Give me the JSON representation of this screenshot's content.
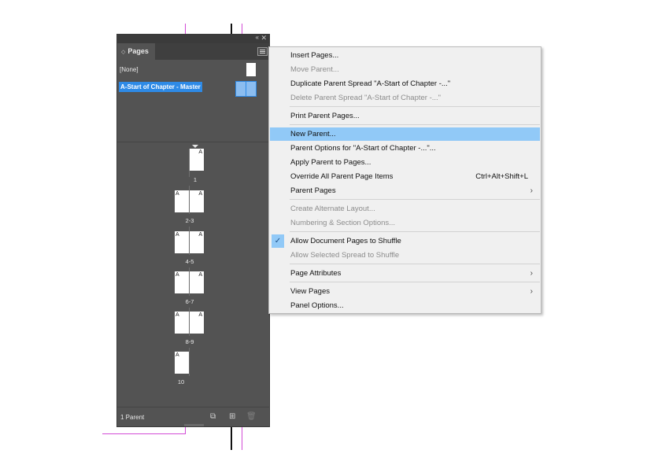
{
  "panel": {
    "tab_label": "Pages",
    "collapse_glyph": "«",
    "close_glyph": "✕",
    "parents": [
      {
        "label": "[None]"
      },
      {
        "label": "A-Start of Chapter - Master",
        "selected": true
      }
    ],
    "spreads": [
      {
        "label": "1",
        "pages": [
          "A"
        ]
      },
      {
        "label": "2-3",
        "pages": [
          "A",
          "A"
        ]
      },
      {
        "label": "4-5",
        "pages": [
          "A",
          "A"
        ]
      },
      {
        "label": "6-7",
        "pages": [
          "A",
          "A"
        ]
      },
      {
        "label": "8-9",
        "pages": [
          "A",
          "A"
        ]
      },
      {
        "label": "10",
        "pages": [
          "A"
        ]
      }
    ],
    "status": "1 Parent",
    "footer_icons": [
      "edit-page-size-icon",
      "new-page-icon",
      "delete-page-icon"
    ]
  },
  "menu": {
    "items": [
      {
        "label": "Insert Pages...",
        "disabled": false
      },
      {
        "label": "Move Parent...",
        "disabled": true
      },
      {
        "label": "Duplicate Parent Spread \"A-Start of Chapter -...\"",
        "disabled": false
      },
      {
        "label": "Delete Parent Spread \"A-Start of Chapter -...\"",
        "disabled": true
      },
      {
        "label": "Print Parent Pages...",
        "disabled": false
      },
      {
        "label": "New Parent...",
        "disabled": false,
        "highlighted": true
      },
      {
        "label": "Parent Options for \"A-Start of Chapter -...\"...",
        "disabled": false
      },
      {
        "label": "Apply Parent to Pages...",
        "disabled": false
      },
      {
        "label": "Override All Parent Page Items",
        "disabled": false,
        "shortcut": "Ctrl+Alt+Shift+L"
      },
      {
        "label": "Parent Pages",
        "disabled": false,
        "submenu": true
      },
      {
        "label": "Create Alternate Layout...",
        "disabled": true
      },
      {
        "label": "Numbering & Section Options...",
        "disabled": true
      },
      {
        "label": "Allow Document Pages to Shuffle",
        "disabled": false,
        "checked": true
      },
      {
        "label": "Allow Selected Spread to Shuffle",
        "disabled": true
      },
      {
        "label": "Page Attributes",
        "disabled": false,
        "submenu": true
      },
      {
        "label": "View Pages",
        "disabled": false,
        "submenu": true
      },
      {
        "label": "Panel Options...",
        "disabled": false
      }
    ],
    "submenu_glyph": "›",
    "check_glyph": "✓"
  },
  "colors": {
    "panel_bg": "#535353",
    "selection_blue": "#2e8ae6",
    "menu_highlight": "#91c9f7",
    "guide_magenta": "#d24bd6"
  }
}
